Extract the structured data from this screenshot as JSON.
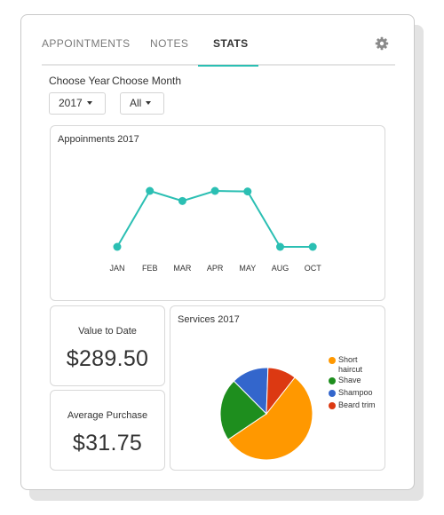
{
  "tabs": [
    {
      "label": "APPOINTMENTS"
    },
    {
      "label": "NOTES"
    },
    {
      "label": "STATS"
    }
  ],
  "filters": {
    "year_label": "Choose Year",
    "month_label": "Choose Month",
    "year_value": "2017",
    "month_value": "All"
  },
  "appointments_panel": {
    "title": "Appoinments 2017"
  },
  "value_to_date": {
    "label": "Value to Date",
    "amount": "$289.50"
  },
  "average_purchase": {
    "label": "Average Purchase",
    "amount": "$31.75"
  },
  "services_panel": {
    "title": "Services 2017",
    "legend": [
      {
        "label_line1": "Short",
        "label_line2": "haircut",
        "color": "#ff9800"
      },
      {
        "label_line1": "Shave",
        "label_line2": "",
        "color": "#1e8e1e"
      },
      {
        "label_line1": "Shampoo",
        "label_line2": "",
        "color": "#3366cc"
      },
      {
        "label_line1": "Beard trim",
        "label_line2": "",
        "color": "#dc3912"
      }
    ]
  },
  "colors": {
    "accent": "#2bbfb3"
  },
  "icons": {
    "settings": "gear-icon"
  },
  "chart_data": [
    {
      "type": "line",
      "title": "Appoinments 2017",
      "categories": [
        "JAN",
        "FEB",
        "MAR",
        "APR",
        "MAY",
        "AUG",
        "OCT"
      ],
      "series": [
        {
          "values": [
            0,
            1,
            0.82,
            1,
            0.99,
            0,
            0
          ]
        }
      ],
      "note_scale": "no y axis shown; values are relative levels",
      "color": "#2bbfb3",
      "grid": false
    },
    {
      "type": "pie",
      "title": "Services 2017",
      "categories": [
        "Short haircut",
        "Shave",
        "Shampoo",
        "Beard trim"
      ],
      "values": [
        55,
        22,
        13,
        10
      ],
      "colors": [
        "#ff9800",
        "#1e8e1e",
        "#3366cc",
        "#dc3912"
      ],
      "legend": "right"
    }
  ]
}
